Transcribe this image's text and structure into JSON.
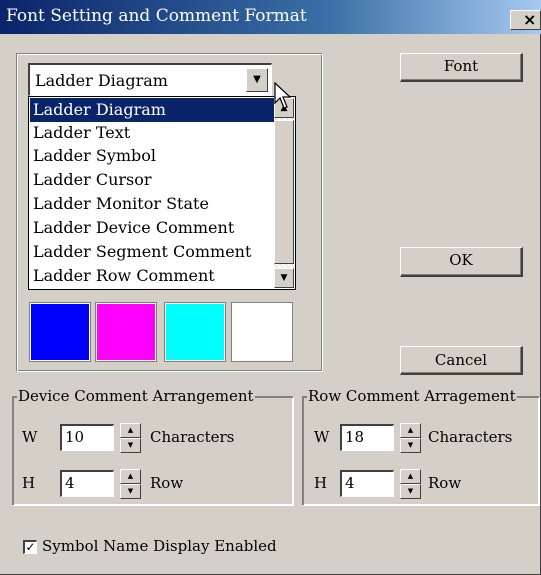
{
  "window": {
    "title": "Font Setting and Comment Format",
    "close_glyph": "×"
  },
  "buttons": {
    "font": "Font",
    "ok": "OK",
    "cancel": "Cancel"
  },
  "display_target": {
    "selected": "Ladder Diagram",
    "options": [
      "Ladder Diagram",
      "Ladder Text",
      "Ladder Symbol",
      "Ladder Cursor",
      "Ladder Monitor State",
      "Ladder Device Comment",
      "Ladder Segment Comment",
      "Ladder Row Comment"
    ],
    "highlighted_index": 0
  },
  "color_swatches": [
    {
      "name": "blue",
      "color": "#0000ff"
    },
    {
      "name": "magenta",
      "color": "#ff00ff"
    },
    {
      "name": "cyan",
      "color": "#00ffff"
    },
    {
      "name": "white",
      "color": "#ffffff"
    }
  ],
  "device_comment": {
    "legend": "Device Comment Arrangement",
    "w_label": "W",
    "w_value": "10",
    "w_unit": "Characters",
    "h_label": "H",
    "h_value": "4",
    "h_unit": "Row"
  },
  "row_comment": {
    "legend": "Row Comment Arragement",
    "w_label": "W",
    "w_value": "18",
    "w_unit": "Characters",
    "h_label": "H",
    "h_value": "4",
    "h_unit": "Row"
  },
  "symbol_display": {
    "label": "Symbol Name Display Enabled",
    "checked": true,
    "check_glyph": "✓"
  }
}
